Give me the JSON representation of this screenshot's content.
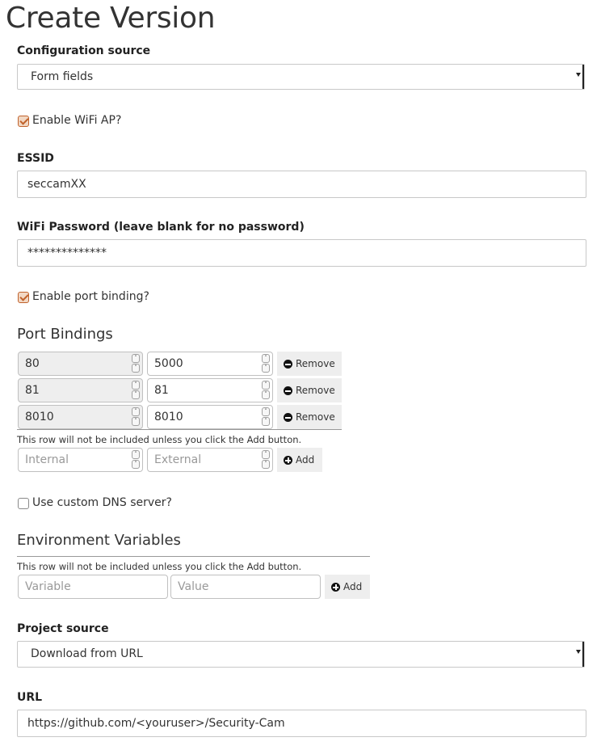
{
  "page_title": "Create Version",
  "config_source": {
    "label": "Configuration source",
    "selected": "Form fields"
  },
  "wifi_ap": {
    "label": "Enable WiFi AP?",
    "checked": true
  },
  "essid": {
    "label": "ESSID",
    "value": "seccamXX"
  },
  "wifi_password": {
    "label": "WiFi Password (leave blank for no password)",
    "value": "**************"
  },
  "port_binding": {
    "label": "Enable port binding?",
    "checked": true
  },
  "port_bindings": {
    "heading": "Port Bindings",
    "rows": [
      {
        "internal": "80",
        "external": "5000"
      },
      {
        "internal": "81",
        "external": "81"
      },
      {
        "internal": "8010",
        "external": "8010"
      }
    ],
    "remove_label": "Remove",
    "note": "This row will not be included unless you click the Add button.",
    "internal_placeholder": "Internal",
    "external_placeholder": "External",
    "add_label": "Add"
  },
  "custom_dns": {
    "label": "Use custom DNS server?",
    "checked": false
  },
  "env_vars": {
    "heading": "Environment Variables",
    "note": "This row will not be included unless you click the Add button.",
    "variable_placeholder": "Variable",
    "value_placeholder": "Value",
    "add_label": "Add"
  },
  "project_source": {
    "label": "Project source",
    "selected": "Download from URL"
  },
  "url": {
    "label": "URL",
    "value": "https://github.com/<youruser>/Security-Cam"
  },
  "colors": {
    "checkbox_accent": "#c0622c",
    "button_bg": "#eeeeee",
    "readonly_bg": "#eeeeee"
  }
}
